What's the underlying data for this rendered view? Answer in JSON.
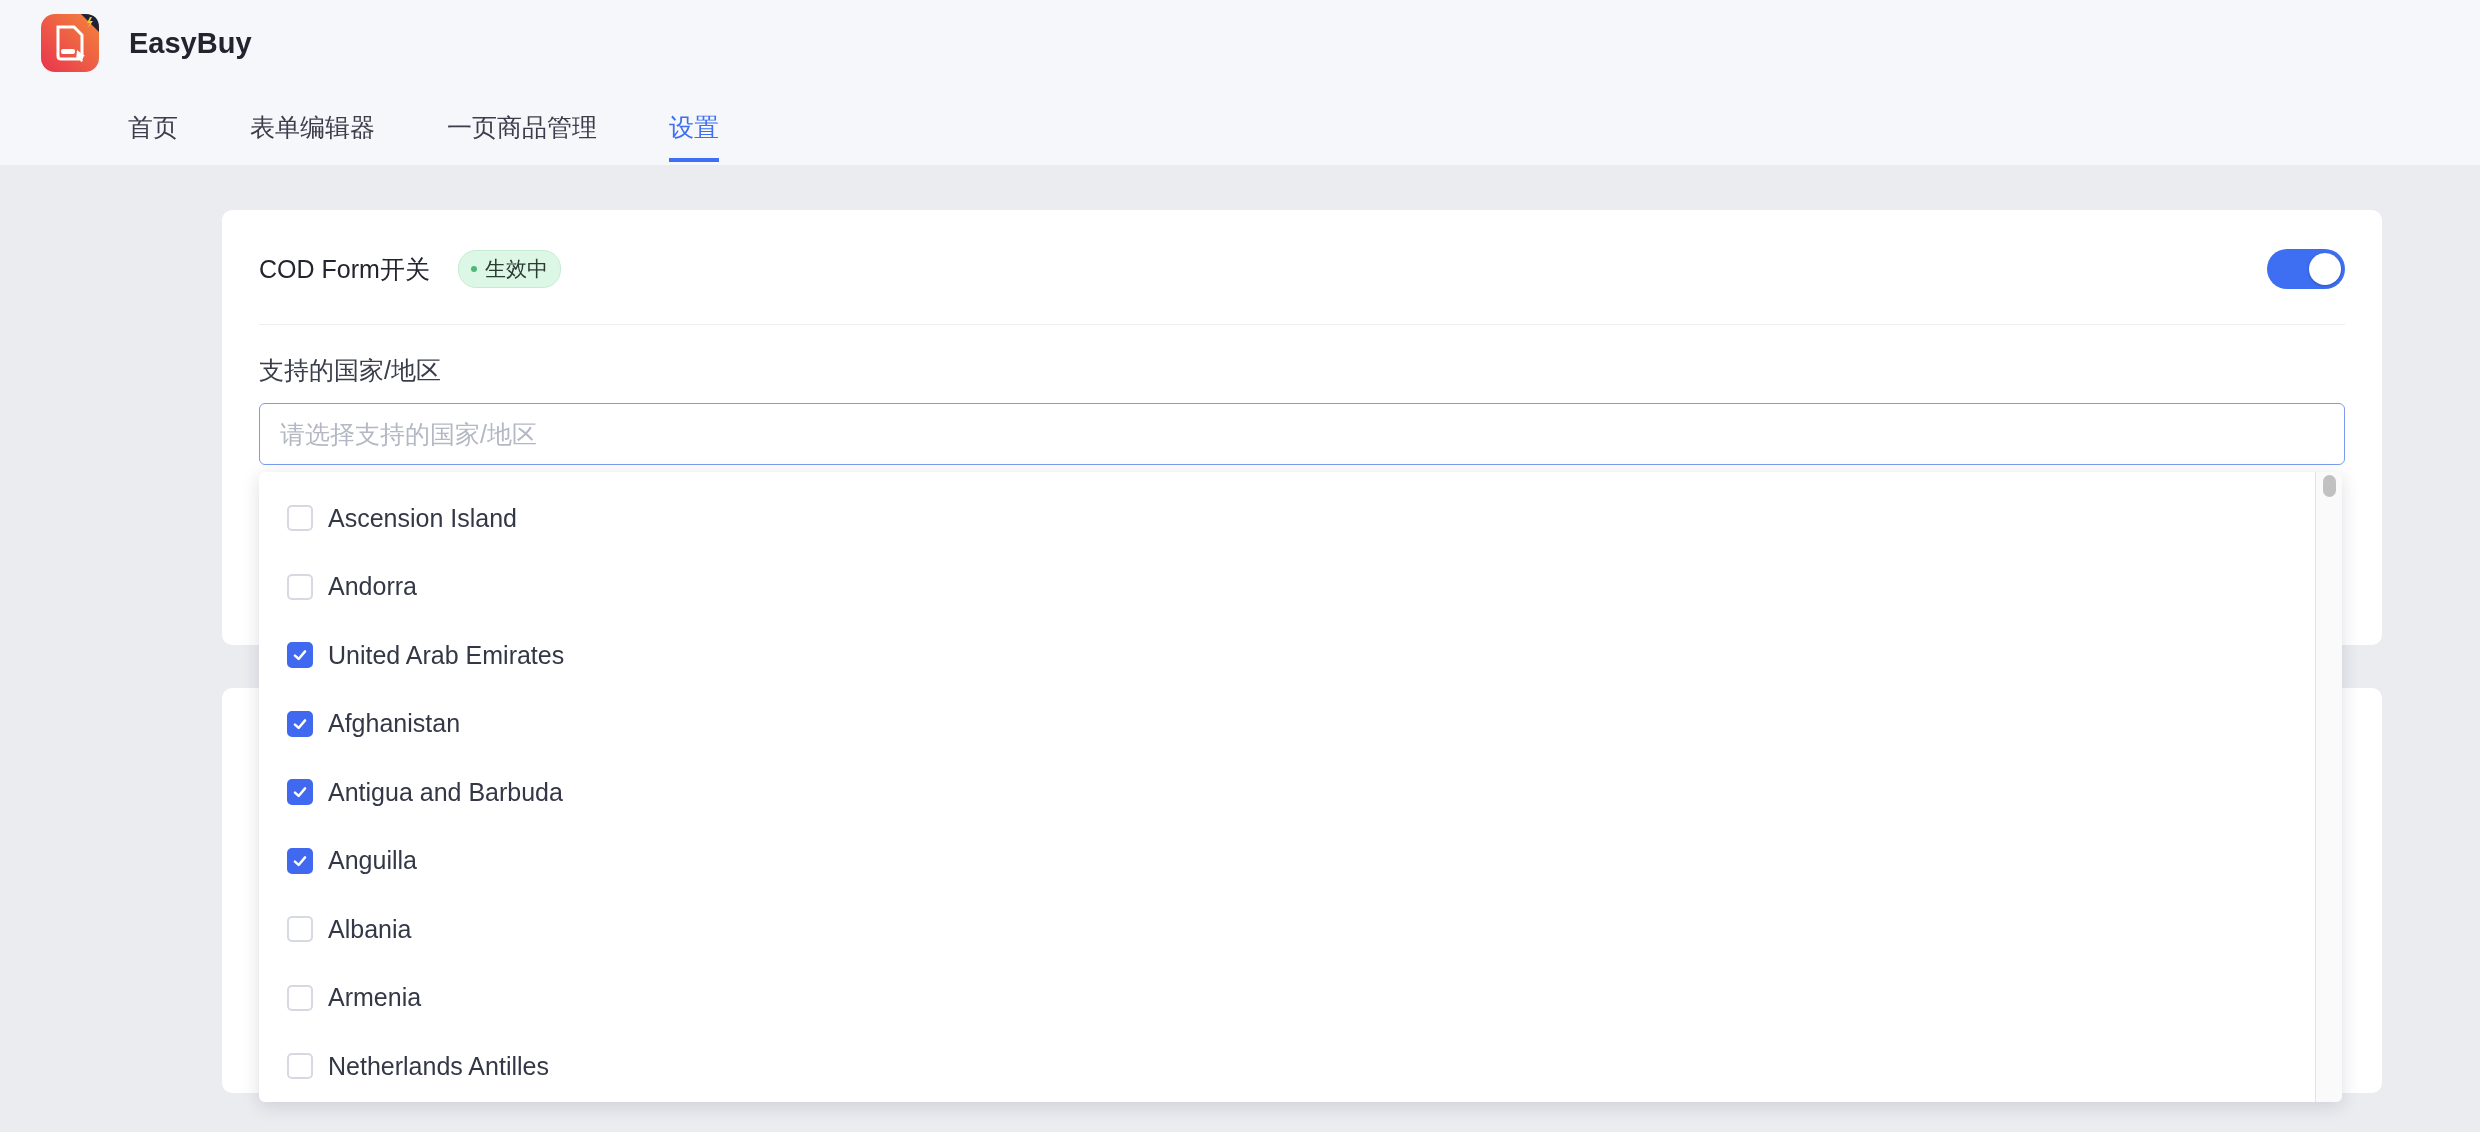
{
  "app": {
    "name": "EasyBuy"
  },
  "tabs": [
    {
      "label": "首页",
      "selected": false
    },
    {
      "label": "表单编辑器",
      "selected": false
    },
    {
      "label": "一页商品管理",
      "selected": false
    },
    {
      "label": "设置",
      "selected": true
    }
  ],
  "cod_form": {
    "title": "COD Form开关",
    "status": "生效中",
    "on": true
  },
  "countries": {
    "label": "支持的国家/地区",
    "placeholder": "请选择支持的国家/地区",
    "options": [
      {
        "label": "Ascension Island",
        "checked": false
      },
      {
        "label": "Andorra",
        "checked": false
      },
      {
        "label": "United Arab Emirates",
        "checked": true
      },
      {
        "label": "Afghanistan",
        "checked": true
      },
      {
        "label": "Antigua and Barbuda",
        "checked": true
      },
      {
        "label": "Anguilla",
        "checked": true
      },
      {
        "label": "Albania",
        "checked": false
      },
      {
        "label": "Armenia",
        "checked": false
      },
      {
        "label": "Netherlands Antilles",
        "checked": false
      }
    ]
  }
}
